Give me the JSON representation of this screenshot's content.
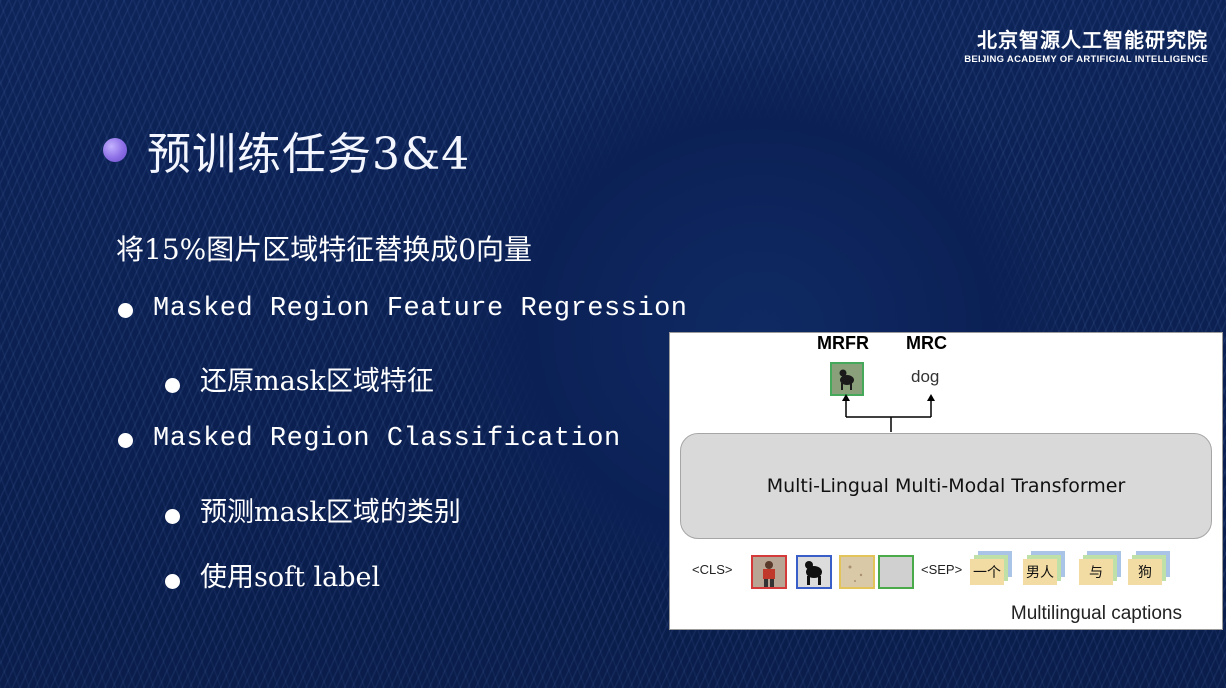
{
  "logo": {
    "cn": "北京智源人工智能研究院",
    "en": "BEIJING ACADEMY OF ARTIFICIAL INTELLIGENCE"
  },
  "title": "预训练任务3&4",
  "intro": "将15%图片区域特征替换成0向量",
  "bullets": {
    "mrfr": "Masked Region Feature Regression",
    "mrfr_sub": "还原mask区域特征",
    "mrc": "Masked Region Classification",
    "mrc_sub": "预测mask区域的类别",
    "soft_label": "使用soft label"
  },
  "diagram": {
    "mrfr_label": "MRFR",
    "mrc_label": "MRC",
    "mrc_output": "dog",
    "transformer_label": "Multi-Lingual Multi-Modal Transformer",
    "cls_token": "<CLS>",
    "sep_token": "<SEP>",
    "caption_tokens": [
      "一个",
      "男人",
      "与",
      "狗"
    ],
    "caption": "Multilingual captions"
  }
}
